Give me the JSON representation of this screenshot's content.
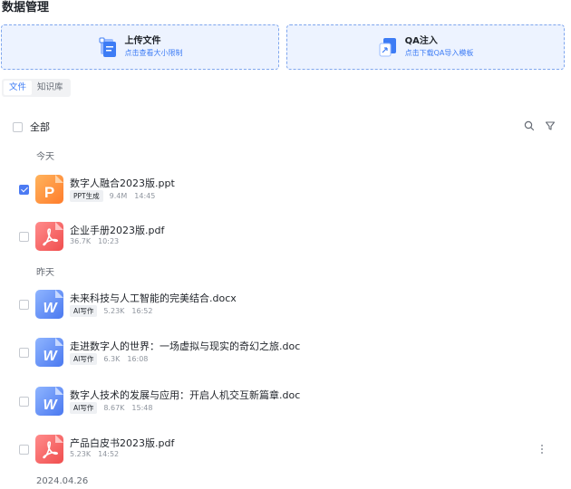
{
  "page": {
    "title": "数据管理"
  },
  "upload_cards": [
    {
      "title": "上传文件",
      "subtitle": "点击查看大小限制",
      "icon": "upload-file-icon"
    },
    {
      "title": "QA注入",
      "subtitle": "点击下载QA导入模板",
      "icon": "qa-inject-icon"
    }
  ],
  "tabs": [
    {
      "label": "文件",
      "active": true
    },
    {
      "label": "知识库",
      "active": false
    }
  ],
  "list": {
    "select_all_label": "全部",
    "tools": [
      "search-icon",
      "filter-icon"
    ]
  },
  "groups": [
    {
      "label": "今天"
    },
    {
      "label": "昨天"
    },
    {
      "label": "2024.04.26"
    }
  ],
  "files": [
    {
      "name": "数字人融合2023版.ppt",
      "tag": "PPT生成",
      "size": "9.4M",
      "time": "14:45",
      "type": "ppt",
      "checked": true
    },
    {
      "name": "企业手册2023版.pdf",
      "tag": "",
      "size": "36.7K",
      "time": "10:23",
      "type": "pdf",
      "checked": false
    },
    {
      "name": "未来科技与人工智能的完美结合.docx",
      "tag": "AI写作",
      "size": "5.23K",
      "time": "16:52",
      "type": "doc",
      "checked": false
    },
    {
      "name": "走进数字人的世界：一场虚拟与现实的奇幻之旅.doc",
      "tag": "AI写作",
      "size": "6.3K",
      "time": "16:08",
      "type": "doc",
      "checked": false
    },
    {
      "name": "数字人技术的发展与应用：开启人机交互新篇章.doc",
      "tag": "AI写作",
      "size": "8.67K",
      "time": "15:48",
      "type": "doc",
      "checked": false
    },
    {
      "name": "产品白皮书2023版.pdf",
      "tag": "",
      "size": "5.23K",
      "time": "14:52",
      "type": "pdf",
      "checked": false
    }
  ],
  "colors": {
    "accent": "#3d7cf5",
    "card_bg": "#edf3ff",
    "ppt": "#ff8a35",
    "pdf": "#f25555",
    "doc": "#4a78f0"
  }
}
